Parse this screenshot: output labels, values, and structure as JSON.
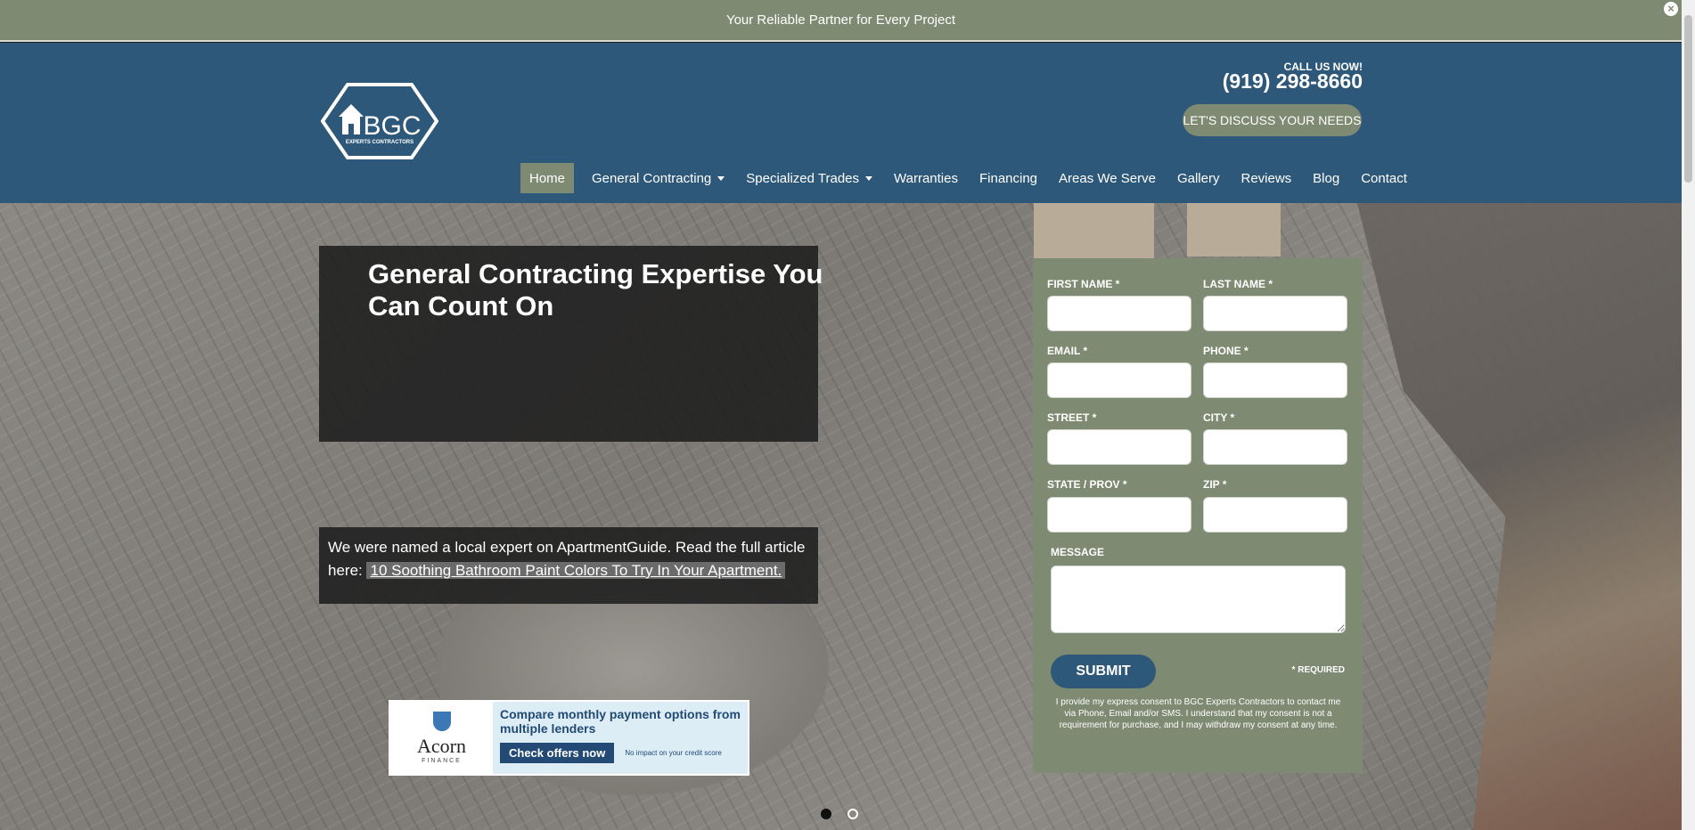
{
  "announcement": {
    "text": "Your Reliable Partner for Every Project",
    "close_glyph": "×"
  },
  "header": {
    "logo_text": "BGC",
    "logo_subtext": "EXPERTS CONTRACTORS",
    "call_label": "CALL US NOW!",
    "phone": "(919) 298-8660",
    "cta_label": "LET'S DISCUSS YOUR NEEDS"
  },
  "nav": {
    "items": [
      {
        "label": "Home"
      },
      {
        "label": "General Contracting"
      },
      {
        "label": "Specialized Trades"
      },
      {
        "label": "Warranties"
      },
      {
        "label": "Financing"
      },
      {
        "label": "Areas We Serve"
      },
      {
        "label": "Gallery"
      },
      {
        "label": "Reviews"
      },
      {
        "label": "Blog"
      },
      {
        "label": "Contact"
      }
    ]
  },
  "hero": {
    "headline": "General Contracting Expertise You Can Count On",
    "article_text": "We were named a local expert on ApartmentGuide. Read the full article here:",
    "article_link": "10 Soothing Bathroom Paint Colors To Try In Your Apartment.",
    "slides": {
      "total": 2,
      "active": 1
    }
  },
  "ad": {
    "brand": "Acorn",
    "brand_sub": "FINANCE",
    "title": "Compare monthly payment options from multiple lenders",
    "button": "Check offers now",
    "note": "No impact on your credit score"
  },
  "form": {
    "first_name": "FIRST NAME *",
    "last_name": "LAST NAME *",
    "email": "EMAIL *",
    "phone": "PHONE *",
    "street": "STREET *",
    "city": "CITY *",
    "state": "STATE / PROV *",
    "zip": "ZIP *",
    "message": "MESSAGE",
    "submit": "SUBMIT",
    "required_note": "* REQUIRED",
    "consent": "I provide my express consent to BGC Experts Contractors to contact me via Phone, Email and/or SMS. I understand that my consent is not a requirement for purchase, and I may withdraw my consent at any time."
  },
  "colors": {
    "header_blue": "#2d5879",
    "accent_green": "#7f8a72",
    "overlay_dark": "#1e1e1e"
  }
}
